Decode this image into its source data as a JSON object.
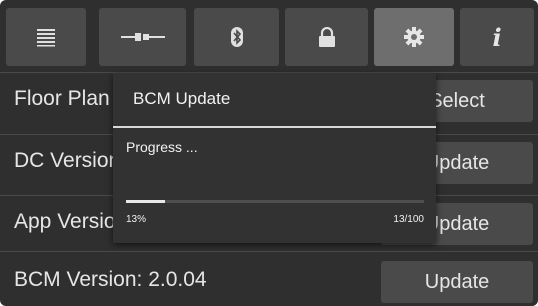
{
  "tabs": [
    {
      "icon": "list-icon",
      "active": false
    },
    {
      "icon": "cable-connector-icon",
      "active": false
    },
    {
      "icon": "bluetooth-icon",
      "active": false
    },
    {
      "icon": "lock-icon",
      "active": false
    },
    {
      "icon": "gear-icon",
      "active": true
    },
    {
      "icon": "info-icon",
      "label": "i",
      "active": false
    }
  ],
  "rows": [
    {
      "label": "Floor Plan",
      "button": "Select"
    },
    {
      "label": "DC Version",
      "button": "Update"
    },
    {
      "label": "App Version",
      "button": "Update"
    },
    {
      "label": "BCM Version:  2.0.04",
      "button": "Update"
    }
  ],
  "dialog": {
    "title": "BCM Update",
    "message": "Progress ...",
    "progress_fraction": 0.13,
    "percent_label": "13%",
    "count_label": "13/100"
  },
  "colors": {
    "background": "#2f2f2f",
    "tab": "#4a4a4a",
    "tab_active": "#6e6e6e",
    "dialog": "#323232",
    "text": "#e6e6e6"
  }
}
